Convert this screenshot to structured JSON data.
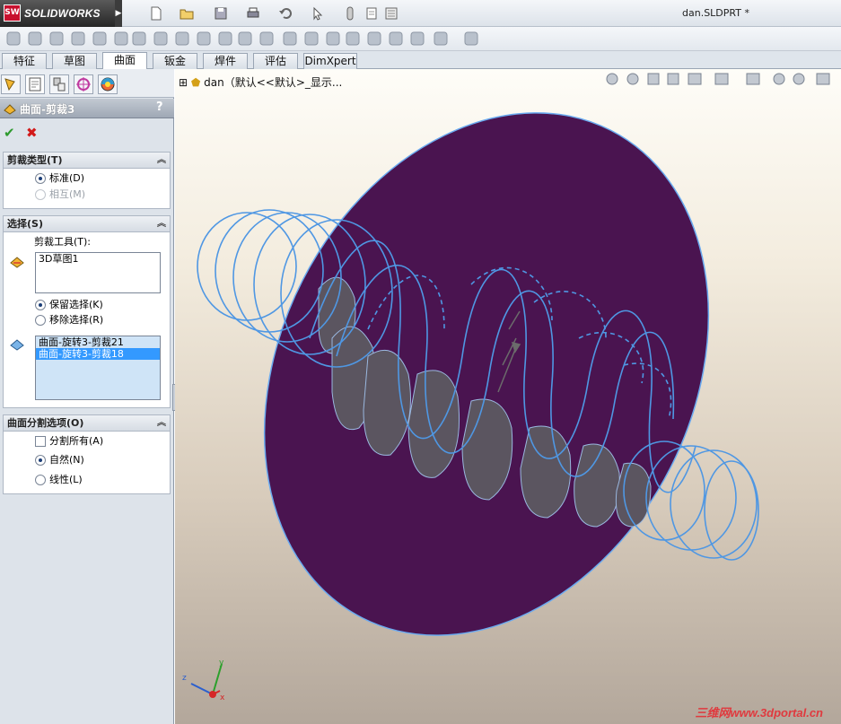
{
  "app": {
    "logo_badge": "SW",
    "logo_text": "SOLIDWORKS",
    "document_title": "dan.SLDPRT *"
  },
  "command_tabs": [
    "特征",
    "草图",
    "曲面",
    "钣金",
    "焊件",
    "评估",
    "DimXpert"
  ],
  "active_command_tab": "曲面",
  "property_manager": {
    "title": "曲面-剪裁3",
    "help": "?",
    "ok_glyph": "✔",
    "cancel_glyph": "✖",
    "trim_type": {
      "header": "剪裁类型(T)",
      "options": [
        {
          "label": "标准(D)",
          "selected": true,
          "enabled": true
        },
        {
          "label": "相互(M)",
          "selected": false,
          "enabled": false
        }
      ]
    },
    "selection": {
      "header": "选择(S)",
      "trim_tool_label": "剪裁工具(T):",
      "trim_tools": [
        "3D草图1"
      ],
      "keep_options": [
        {
          "label": "保留选择(K)",
          "selected": true
        },
        {
          "label": "移除选择(R)",
          "selected": false
        }
      ],
      "pieces": [
        {
          "label": "曲面-旋转3-剪裁21",
          "selected": false
        },
        {
          "label": "曲面-旋转3-剪裁18",
          "selected": true
        }
      ]
    },
    "split_options": {
      "header": "曲面分割选项(O)",
      "split_all": {
        "label": "分割所有(A)",
        "checked": false
      },
      "options": [
        {
          "label": "自然(N)",
          "selected": true
        },
        {
          "label": "线性(L)",
          "selected": false
        }
      ]
    }
  },
  "viewport": {
    "tree_flyout": "dan（默认<<默认>_显示...",
    "watermark": "三维网www.3dportal.cn",
    "triad": {
      "x": "x",
      "y": "y",
      "z": "z"
    }
  },
  "colors": {
    "surface": "#4a1450",
    "curves": "#4f97e3",
    "selection": "#3399ff"
  }
}
